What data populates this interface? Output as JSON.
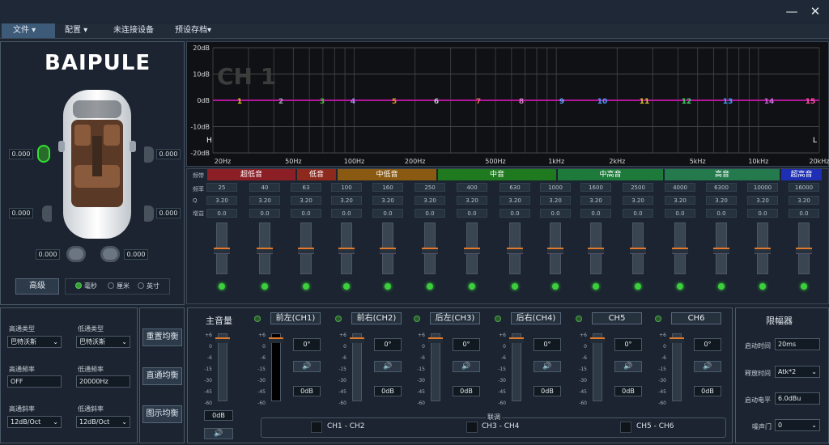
{
  "window": {
    "minimize_glyph": "—",
    "close_glyph": "✕"
  },
  "menu": {
    "file": "文件 ▾",
    "config": "配置 ▾",
    "status": "未连接设备",
    "preset": "预设存档▾"
  },
  "brand": {
    "logo": "BAIPULE"
  },
  "car": {
    "values": [
      "0.000",
      "0.000",
      "0.000",
      "0.000",
      "0.000",
      "0.000"
    ],
    "advanced_button": "高级",
    "units": [
      "毫秒",
      "厘米",
      "英寸"
    ]
  },
  "eq_chart": {
    "channel_watermark": "CH 1",
    "y_ticks": [
      "20dB",
      "10dB",
      "0dB",
      "-10dB",
      "-20dB"
    ],
    "x_ticks": [
      "20Hz",
      "50Hz",
      "100Hz",
      "200Hz",
      "500Hz",
      "1kHz",
      "2kHz",
      "5kHz",
      "10kHz",
      "20kHz"
    ],
    "left_marker": "H",
    "right_marker": "L",
    "points": [
      "1",
      "2",
      "3",
      "4",
      "5",
      "6",
      "7",
      "8",
      "9",
      "10",
      "11",
      "12",
      "13",
      "14",
      "15"
    ],
    "point_colors": [
      "#d8c020",
      "#9aa6b2",
      "#4fbf3f",
      "#a48ce8",
      "#e0902a",
      "#b8c4cc",
      "#e06a5a",
      "#d77fc8",
      "#6aa6ff",
      "#4c9dff",
      "#e0c030",
      "#3fcf6a",
      "#39a6ff",
      "#c86ad8",
      "#ff4fa0"
    ]
  },
  "eq_table": {
    "row_labels": {
      "band": "频带",
      "freq": "频率",
      "q": "Q",
      "gain": "增益"
    },
    "bands": [
      {
        "label": "超低音",
        "color": "#8c1f26"
      },
      {
        "label": "低音",
        "color": "#8e2a1d"
      },
      {
        "label": "中低音",
        "color": "#8b5a12"
      },
      {
        "label": "中音",
        "color": "#1f7a1f"
      },
      {
        "label": "中高音",
        "color": "#1e7a3a"
      },
      {
        "label": "高音",
        "color": "#247a4d"
      },
      {
        "label": "超高音",
        "color": "#1f2fb5"
      }
    ],
    "freqs": [
      "25",
      "40",
      "63",
      "100",
      "160",
      "250",
      "400",
      "630",
      "1000",
      "1600",
      "2500",
      "4000",
      "6300",
      "10000",
      "16000"
    ],
    "qs": [
      "3.20",
      "3.20",
      "3.20",
      "3.20",
      "3.20",
      "3.20",
      "3.20",
      "3.20",
      "3.20",
      "3.20",
      "3.20",
      "3.20",
      "3.20",
      "3.20",
      "3.20"
    ],
    "gains": [
      "0.0",
      "0.0",
      "0.0",
      "0.0",
      "0.0",
      "0.0",
      "0.0",
      "0.0",
      "0.0",
      "0.0",
      "0.0",
      "0.0",
      "0.0",
      "0.0",
      "0.0"
    ]
  },
  "crossover": {
    "hp_type_label": "高通类型",
    "hp_type": "巴特沃斯",
    "lp_type_label": "低通类型",
    "lp_type": "巴特沃斯",
    "hp_freq_label": "高通频率",
    "hp_freq": "OFF",
    "lp_freq_label": "低通频率",
    "lp_freq": "20000Hz",
    "hp_slope_label": "高通斜率",
    "hp_slope": "12dB/Oct",
    "lp_slope_label": "低通斜率",
    "lp_slope": "12dB/Oct"
  },
  "eq_actions": {
    "reset": "重置均衡",
    "bypass": "直通均衡",
    "display": "图示均衡"
  },
  "mixer": {
    "master_label": "主音量",
    "master_value": "0dB",
    "master_mute": "🔊",
    "scale": [
      "+6",
      "0",
      "-6",
      "-15",
      "-30",
      "-45",
      "-60"
    ],
    "channels": [
      {
        "name": "前左(CH1)",
        "delay": "0°",
        "mute": "🔊",
        "gain": "0dB"
      },
      {
        "name": "前右(CH2)",
        "delay": "0°",
        "mute": "🔊",
        "gain": "0dB"
      },
      {
        "name": "后左(CH3)",
        "delay": "0°",
        "mute": "🔊",
        "gain": "0dB"
      },
      {
        "name": "后右(CH4)",
        "delay": "0°",
        "mute": "🔊",
        "gain": "0dB"
      },
      {
        "name": "CH5",
        "delay": "0°",
        "mute": "🔊",
        "gain": "0dB"
      },
      {
        "name": "CH6",
        "delay": "0°",
        "mute": "🔊",
        "gain": "0dB"
      }
    ],
    "link_title": "联调",
    "links": [
      "CH1 - CH2",
      "CH3 - CH4",
      "CH5 - CH6"
    ]
  },
  "limiter": {
    "title": "限幅器",
    "attack_label": "启动时间",
    "attack": "20ms",
    "release_label": "释放时间",
    "release": "Atk*2",
    "threshold_label": "启动电平",
    "threshold": "6.0dBu",
    "gate_label": "噪声门",
    "gate": "0"
  }
}
